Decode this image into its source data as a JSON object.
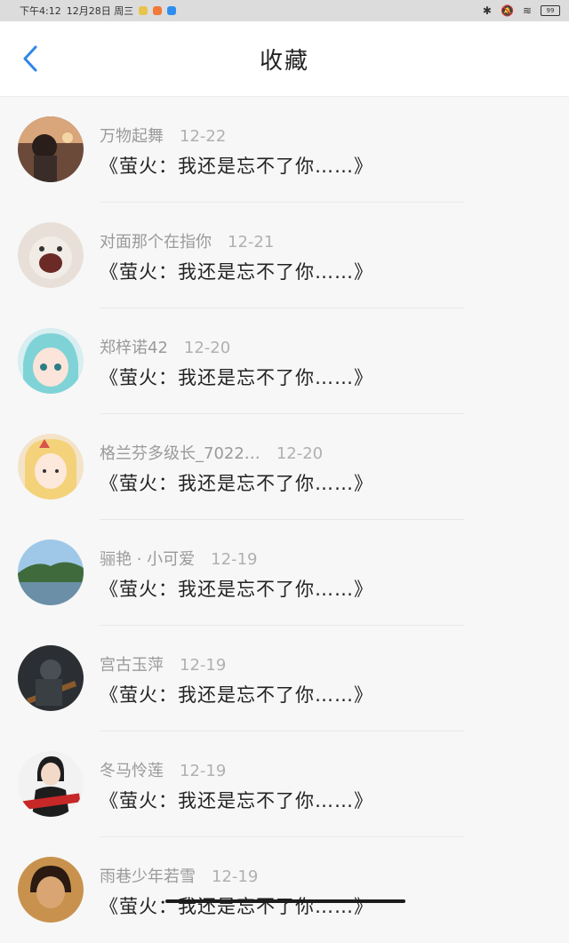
{
  "status_bar": {
    "time": "下午4:12",
    "date": "12月28日 周三",
    "battery": "99"
  },
  "header": {
    "title": "收藏",
    "back_icon": "chevron-left-icon",
    "accent_color": "#2f86e8"
  },
  "items": [
    {
      "name": "万物起舞",
      "date": "12-22",
      "text": "《萤火：我还是忘不了你……》",
      "avatar": "photo-portrait"
    },
    {
      "name": "对面那个在指你",
      "date": "12-21",
      "text": "《萤火：我还是忘不了你……》",
      "avatar": "sticker-face"
    },
    {
      "name": "郑梓诺42",
      "date": "12-20",
      "text": "《萤火：我还是忘不了你……》",
      "avatar": "anime-teal"
    },
    {
      "name": "格兰芬多级长_7022…",
      "date": "12-20",
      "text": "《萤火：我还是忘不了你……》",
      "avatar": "anime-blonde"
    },
    {
      "name": "骊艳 · 小可爱",
      "date": "12-19",
      "text": "《萤火：我还是忘不了你……》",
      "avatar": "landscape"
    },
    {
      "name": "宫古玉萍",
      "date": "12-19",
      "text": "《萤火：我还是忘不了你……》",
      "avatar": "dark-art"
    },
    {
      "name": "冬马怜莲",
      "date": "12-19",
      "text": "《萤火：我还是忘不了你……》",
      "avatar": "woman-photo"
    },
    {
      "name": "雨巷少年若雪",
      "date": "12-19",
      "text": "《萤火：我还是忘不了你……》",
      "avatar": "man-photo"
    }
  ]
}
